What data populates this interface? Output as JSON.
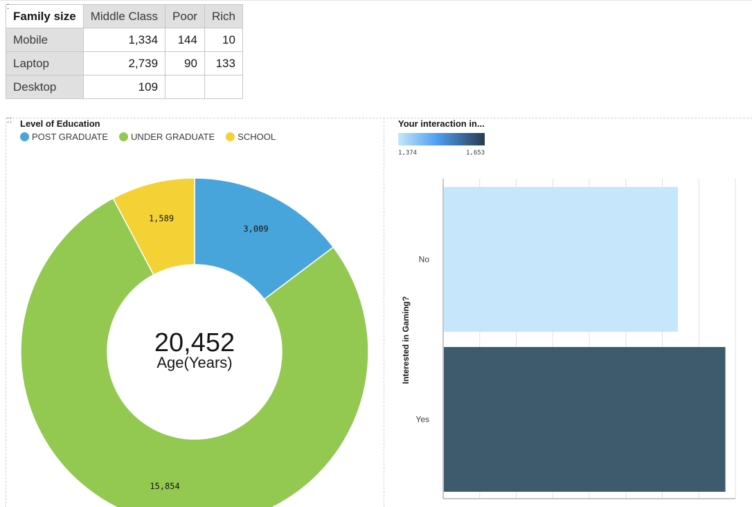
{
  "crosstab": {
    "corner_label": "Family size",
    "columns": [
      "Middle Class",
      "Poor",
      "Rich"
    ],
    "rows": [
      {
        "label": "Mobile",
        "values": [
          "1,334",
          "144",
          "10"
        ]
      },
      {
        "label": "Laptop",
        "values": [
          "2,739",
          "90",
          "133"
        ]
      },
      {
        "label": "Desktop",
        "values": [
          "109",
          "",
          ""
        ]
      }
    ]
  },
  "chart_data": [
    {
      "type": "pie",
      "title": "Level of Education",
      "center_value": "20,452",
      "center_label": "Age(Years)",
      "categories": [
        "POST GRADUATE",
        "UNDER GRADUATE",
        "SCHOOL"
      ],
      "values": [
        3009,
        15854,
        1589
      ],
      "value_labels": [
        "3,009",
        "15,854",
        "1,589"
      ],
      "colors": [
        "#47a5db",
        "#93c951",
        "#f4d135"
      ],
      "legend_placement": "top-left"
    },
    {
      "type": "bar",
      "orientation": "horizontal",
      "title": "Your interaction in...",
      "ylabel": "Interested in Gaming?",
      "categories": [
        "No",
        "Yes"
      ],
      "values": [
        1374,
        1653
      ],
      "color_scale": {
        "min_label": "1,374",
        "max_label": "1,653",
        "min_color": "#c5e6fb",
        "mid_color": "#4d9ff0",
        "max_color": "#3b5c6d"
      },
      "bar_colors": [
        "#c5e6fb",
        "#3d5b6c"
      ],
      "grid": true
    }
  ]
}
